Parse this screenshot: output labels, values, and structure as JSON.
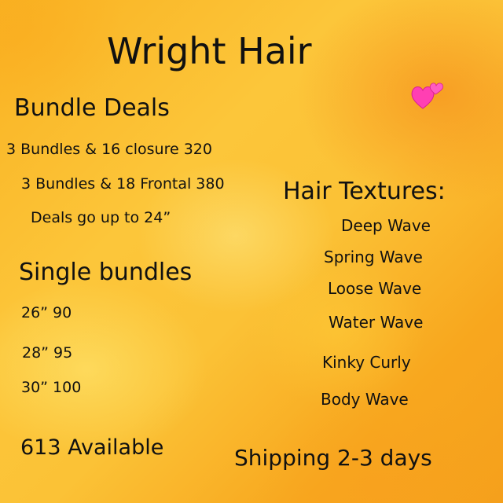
{
  "title": "Wright Hair",
  "bundle_deals": {
    "heading": "Bundle Deals",
    "rows": [
      "3 Bundles & 16 closure 320",
      "3 Bundles & 18 Frontal 380",
      "Deals go up to 24”"
    ]
  },
  "single_bundles": {
    "heading": "Single bundles",
    "rows": [
      "26” 90",
      "28” 95",
      "30” 100"
    ]
  },
  "availability": "613 Available",
  "textures": {
    "heading": "Hair Textures:",
    "items": [
      "Deep Wave",
      "Spring Wave",
      "Loose Wave",
      "Water Wave",
      "Kinky Curly",
      "Body Wave"
    ]
  },
  "shipping": "Shipping 2-3 days",
  "decor": {
    "hearts_icon": "two-hearts-icon",
    "heart_color": "#ff3fb3",
    "background_colors": [
      "#f9b222",
      "#fcc63a",
      "#f5a01c"
    ]
  }
}
